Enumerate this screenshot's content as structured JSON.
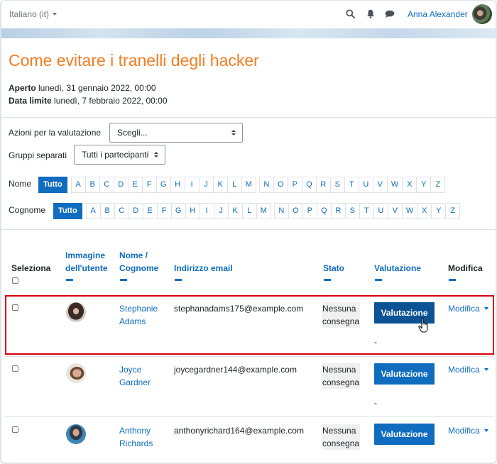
{
  "navbar": {
    "language": "Italiano (it)",
    "user_name": "Anna Alexander",
    "icons": [
      "search-icon",
      "bell-icon",
      "chat-icon"
    ]
  },
  "assignment": {
    "title": "Come evitare i tranelli degli hacker",
    "opened_label": "Aperto",
    "opened_value": "lunedì, 31 gennaio 2022, 00:00",
    "due_label": "Data limite",
    "due_value": "lunedì, 7 febbraio 2022, 00:00"
  },
  "controls": {
    "grading_actions_label": "Azioni per la valutazione",
    "grading_actions_value": "Scegli...",
    "groups_label": "Gruppi separati",
    "groups_value": "Tutti i partecipanti"
  },
  "filters": {
    "first_name_label": "Nome",
    "last_name_label": "Cognome",
    "all_label": "Tutto",
    "letters": [
      "A",
      "B",
      "C",
      "D",
      "E",
      "F",
      "G",
      "H",
      "I",
      "J",
      "K",
      "L",
      "M",
      "N",
      "O",
      "P",
      "Q",
      "R",
      "S",
      "T",
      "U",
      "V",
      "W",
      "X",
      "Y",
      "Z"
    ]
  },
  "table": {
    "headers": {
      "select": "Seleziona",
      "image_line1": "Immagine",
      "image_line2": "dell'utente",
      "name_line1": "Nome /",
      "name_line2": "Cognome",
      "email": "Indirizzo email",
      "status": "Stato",
      "grade": "Valutazione",
      "edit": "Modifica"
    },
    "rows": [
      {
        "first": "Stephanie",
        "last": "Adams",
        "email": "stephanadams175@example.com",
        "status_line1": "Nessuna",
        "status_line2": "consegna",
        "grade_button": "Valutazione",
        "grade_value": "-",
        "edit": "Modifica",
        "highlighted": true
      },
      {
        "first": "Joyce",
        "last": "Gardner",
        "email": "joycegardner144@example.com",
        "status_line1": "Nessuna",
        "status_line2": "consegna",
        "grade_button": "Valutazione",
        "grade_value": "-",
        "edit": "Modifica",
        "highlighted": false
      },
      {
        "first": "Anthony",
        "last": "Richards",
        "email": "anthonyrichard164@example.com",
        "status_line1": "Nessuna",
        "status_line2": "consegna",
        "grade_button": "Valutazione",
        "grade_value": "",
        "edit": "Modifica",
        "highlighted": false
      }
    ]
  },
  "colors": {
    "brand_blue": "#0f6cbf",
    "title_orange": "#f47c21",
    "highlight_red": "#d9000d"
  }
}
